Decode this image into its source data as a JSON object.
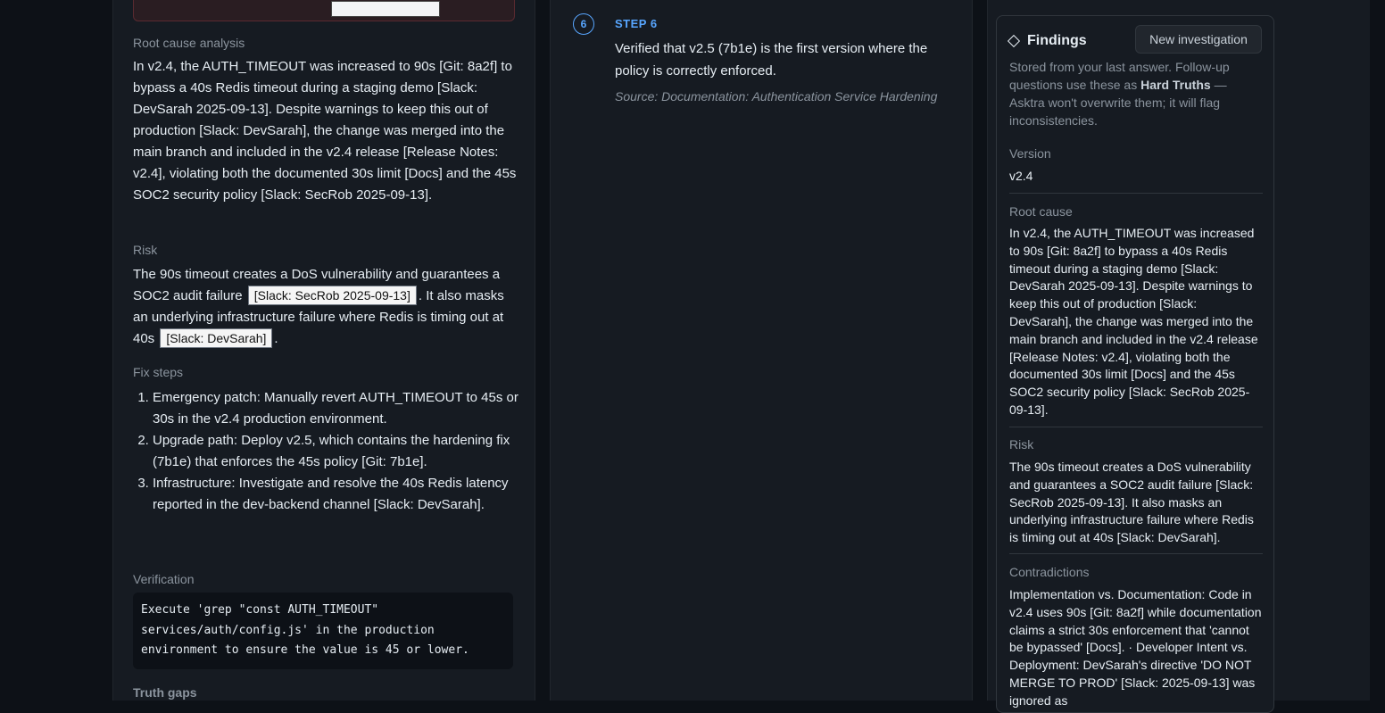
{
  "report": {
    "root_cause_label": "Root cause analysis",
    "root_cause_text": "In v2.4, the AUTH_TIMEOUT was increased to 90s [Git: 8a2f] to bypass a 40s Redis timeout during a staging demo [Slack: DevSarah 2025-09-13]. Despite warnings to keep this out of production [Slack: DevSarah], the change was merged into the main branch and included in the v2.4 release [Release Notes: v2.4], violating both the documented 30s limit [Docs] and the 45s SOC2 security policy [Slack: SecRob 2025-09-13].",
    "risk_label": "Risk",
    "risk_part1": "The 90s timeout creates a DoS vulnerability and guarantees a SOC2 audit failure",
    "risk_cite1": "[Slack: SecRob 2025-09-13]",
    "risk_part2": ". It also masks an underlying infrastructure failure where Redis is timing out at 40s",
    "risk_cite2": "[Slack: DevSarah]",
    "risk_part3": ".",
    "fix_label": "Fix steps",
    "fix_steps": [
      "Emergency patch: Manually revert AUTH_TIMEOUT to 45s or 30s in the v2.4 production environment.",
      "Upgrade path: Deploy v2.5, which contains the hardening fix (7b1e) that enforces the 45s policy [Git: 7b1e].",
      "Infrastructure: Investigate and resolve the 40s Redis latency reported in the dev-backend channel [Slack: DevSarah]."
    ],
    "verification_label": "Verification",
    "verification_code": "Execute 'grep \"const AUTH_TIMEOUT\" services/auth/config.js' in the production environment to ensure the value is 45 or lower.",
    "truth_gaps_label": "Truth gaps"
  },
  "step": {
    "number": "6",
    "label": "STEP 6",
    "text": "Verified that v2.5 (7b1e) is the first version where the policy is correctly enforced.",
    "source": "Source: Documentation: Authentication Service Hardening"
  },
  "findings": {
    "title": "Findings",
    "icon": "diamond-icon",
    "new_button": "New investigation",
    "note_part1": "Stored from your last answer. Follow-up questions use these as ",
    "note_bold": "Hard Truths",
    "note_part2": " — Asktra won't overwrite them; it will flag inconsistencies.",
    "version_label": "Version",
    "version_value": "v2.4",
    "root_label": "Root cause",
    "root_value": "In v2.4, the AUTH_TIMEOUT was increased to 90s [Git: 8a2f] to bypass a 40s Redis timeout during a staging demo [Slack: DevSarah 2025-09-13]. Despite warnings to keep this out of production [Slack: DevSarah], the change was merged into the main branch and included in the v2.4 release [Release Notes: v2.4], violating both the documented 30s limit [Docs] and the 45s SOC2 security policy [Slack: SecRob 2025-09-13].",
    "risk_label": "Risk",
    "risk_value": "The 90s timeout creates a DoS vulnerability and guarantees a SOC2 audit failure [Slack: SecRob 2025-09-13]. It also masks an underlying infrastructure failure where Redis is timing out at 40s [Slack: DevSarah].",
    "contradictions_label": "Contradictions",
    "contradictions_value": "Implementation vs. Documentation: Code in v2.4 uses 90s [Git: 8a2f] while documentation claims a strict 30s enforcement that 'cannot be bypassed' [Docs]. · Developer Intent vs. Deployment: DevSarah's directive 'DO NOT MERGE TO PROD' [Slack: 2025-09-13] was ignored as"
  }
}
